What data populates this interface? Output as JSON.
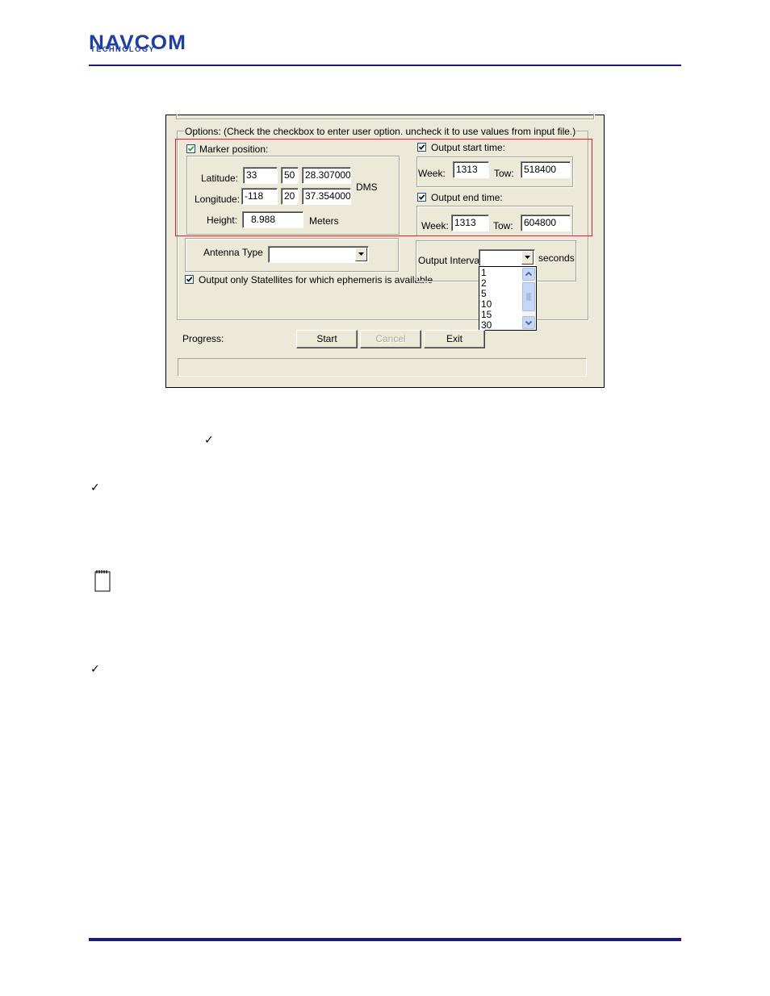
{
  "header": {
    "logo_main": "NAVCOM",
    "logo_sub": "TECHNOLOGY"
  },
  "dialog": {
    "options_legend": "Options: (Check the checkbox to enter user option. uncheck it to use values from input file.)",
    "marker_position_label": "Marker position:",
    "marker_position_checked": true,
    "latitude_label": "Latitude:",
    "latitude_deg": "33",
    "latitude_min": "50",
    "latitude_sec": "28.307000",
    "longitude_label": "Longitude:",
    "longitude_deg": "-118",
    "longitude_min": "20",
    "longitude_sec": "37.354000",
    "dms_label": "DMS",
    "height_label": "Height:",
    "height_value": "8.988",
    "meters_label": "Meters",
    "output_start_label": "Output start time:",
    "output_start_checked": true,
    "start_week_label": "Week:",
    "start_week": "1313",
    "start_tow_label": "Tow:",
    "start_tow": "518400",
    "output_end_label": "Output end time:",
    "output_end_checked": true,
    "end_week_label": "Week:",
    "end_week": "1313",
    "end_tow_label": "Tow:",
    "end_tow": "604800",
    "antenna_type_label": "Antenna Type",
    "antenna_type_value": "",
    "ephemeris_label": "Output only Statellites for which ephemeris is available",
    "ephemeris_checked": true,
    "output_interval_label": "Output Interval",
    "output_interval_value": "",
    "seconds_label": "seconds",
    "interval_options": [
      "1",
      "2",
      "5",
      "10",
      "15",
      "30"
    ],
    "progress_label": "Progress:",
    "start_button": "Start",
    "cancel_button": "Cancel",
    "exit_button": "Exit"
  },
  "body_marks": {
    "checkmark": "✓"
  },
  "colors": {
    "brand_blue": "#1f3fa0",
    "rule_navy": "#1a1a80",
    "highlight_red": "#e02020",
    "dialog_bg": "#ece9d8"
  },
  "icons": [
    "checkmark-icon",
    "note-icon",
    "dropdown-arrow-icon",
    "scroll-up-icon",
    "scroll-down-icon"
  ]
}
